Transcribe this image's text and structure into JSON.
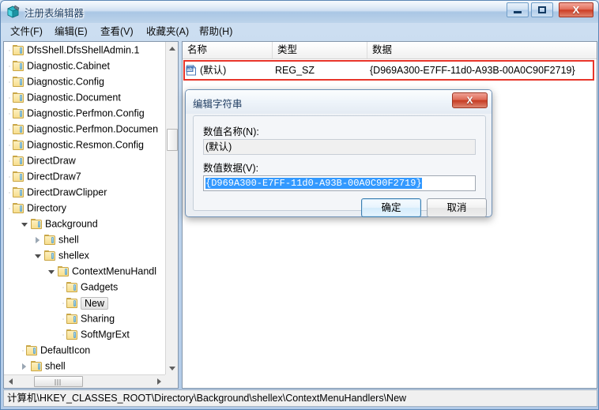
{
  "window": {
    "title": "注册表编辑器",
    "icon": "registry-editor-icon",
    "controls": {
      "minimize": "–",
      "maximize": "□",
      "close": "X"
    }
  },
  "menubar": {
    "items": [
      {
        "label": "文件(F)",
        "name": "menu-file"
      },
      {
        "label": "编辑(E)",
        "name": "menu-edit"
      },
      {
        "label": "查看(V)",
        "name": "menu-view"
      },
      {
        "label": "收藏夹(A)",
        "name": "menu-favorites"
      },
      {
        "label": "帮助(H)",
        "name": "menu-help"
      }
    ]
  },
  "tree": {
    "items": [
      {
        "label": "DfsShell.DfsShellAdmin.1",
        "indent": 0,
        "expander": "none",
        "selected": false
      },
      {
        "label": "Diagnostic.Cabinet",
        "indent": 0,
        "expander": "none",
        "selected": false
      },
      {
        "label": "Diagnostic.Config",
        "indent": 0,
        "expander": "none",
        "selected": false
      },
      {
        "label": "Diagnostic.Document",
        "indent": 0,
        "expander": "none",
        "selected": false
      },
      {
        "label": "Diagnostic.Perfmon.Config",
        "indent": 0,
        "expander": "none",
        "selected": false
      },
      {
        "label": "Diagnostic.Perfmon.Documen",
        "indent": 0,
        "expander": "none",
        "selected": false
      },
      {
        "label": "Diagnostic.Resmon.Config",
        "indent": 0,
        "expander": "none",
        "selected": false
      },
      {
        "label": "DirectDraw",
        "indent": 0,
        "expander": "none",
        "selected": false
      },
      {
        "label": "DirectDraw7",
        "indent": 0,
        "expander": "none",
        "selected": false
      },
      {
        "label": "DirectDrawClipper",
        "indent": 0,
        "expander": "none",
        "selected": false
      },
      {
        "label": "Directory",
        "indent": 0,
        "expander": "none",
        "selected": false
      },
      {
        "label": "Background",
        "indent": 1,
        "expander": "expanded",
        "selected": false
      },
      {
        "label": "shell",
        "indent": 2,
        "expander": "collapsed",
        "selected": false
      },
      {
        "label": "shellex",
        "indent": 2,
        "expander": "expanded",
        "selected": false
      },
      {
        "label": "ContextMenuHandl",
        "indent": 3,
        "expander": "expanded",
        "selected": false
      },
      {
        "label": "Gadgets",
        "indent": 4,
        "expander": "none",
        "selected": false
      },
      {
        "label": "New",
        "indent": 4,
        "expander": "none",
        "selected": true
      },
      {
        "label": "Sharing",
        "indent": 4,
        "expander": "none",
        "selected": false
      },
      {
        "label": "SoftMgrExt",
        "indent": 4,
        "expander": "none",
        "selected": false
      },
      {
        "label": "DefaultIcon",
        "indent": 1,
        "expander": "none",
        "selected": false
      },
      {
        "label": "shell",
        "indent": 1,
        "expander": "collapsed",
        "selected": false
      }
    ]
  },
  "list": {
    "columns": [
      {
        "label": "名称",
        "name": "column-name"
      },
      {
        "label": "类型",
        "name": "column-type"
      },
      {
        "label": "数据",
        "name": "column-data"
      }
    ],
    "rows": [
      {
        "name": "(默认)",
        "type": "REG_SZ",
        "data": "{D969A300-E7FF-11d0-A93B-00A0C90F2719}",
        "icon": "string-value-icon"
      }
    ]
  },
  "highlight": {
    "color": "#e8352a"
  },
  "dialog": {
    "title": "编辑字符串",
    "close_label": "X",
    "value_name_label": "数值名称(N):",
    "value_name": "(默认)",
    "value_data_label": "数值数据(V):",
    "value_data": "{D969A300-E7FF-11d0-A93B-00A0C90F2719}",
    "ok_label": "确定",
    "cancel_label": "取消"
  },
  "statusbar": {
    "path": "计算机\\HKEY_CLASSES_ROOT\\Directory\\Background\\shellex\\ContextMenuHandlers\\New"
  }
}
